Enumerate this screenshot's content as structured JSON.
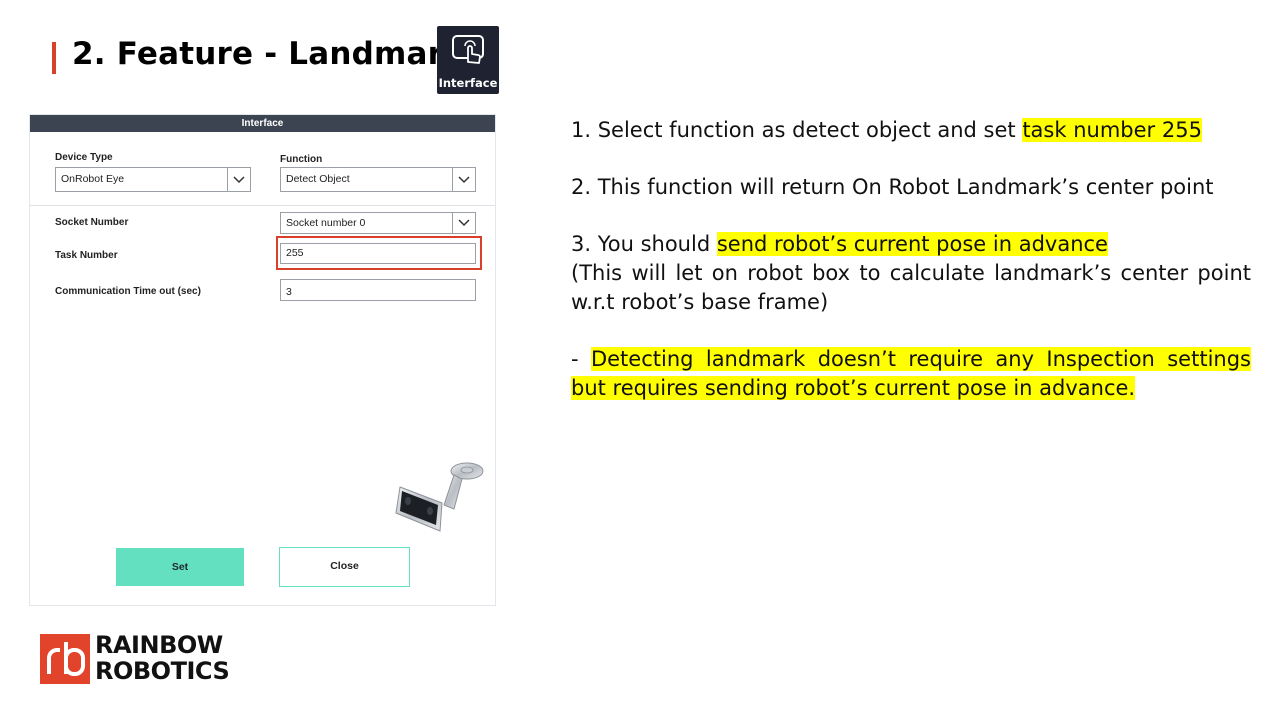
{
  "slide": {
    "title": "2. Feature - Landmark",
    "badge_label": "Interface"
  },
  "dialog": {
    "header": "Interface",
    "device_type_label": "Device Type",
    "device_type_value": "OnRobot Eye",
    "function_label": "Function",
    "function_value": "Detect Object",
    "socket_label": "Socket Number",
    "socket_value": "Socket number 0",
    "task_label": "Task Number",
    "task_value": "255",
    "timeout_label": "Communication Time out (sec)",
    "timeout_value": "3",
    "set_button": "Set",
    "close_button": "Close"
  },
  "notes": {
    "line1_a": "1. Select function as detect object and set ",
    "line1_hl": "task number 255",
    "line2": "2. This function will return On Robot Landmark’s center point",
    "line3_a": "3. You should ",
    "line3_hl": "send robot’s current pose in advance",
    "line4": "(This will let on robot box to calculate landmark’s center point w.r.t robot’s base frame)",
    "line5_a": "- ",
    "line5_hl": "Detecting landmark doesn’t require any Inspection settings but requires sending robot’s current pose in advance."
  },
  "logo": {
    "line1": "RAINBOW",
    "line2": "ROBOTICS"
  },
  "colors": {
    "accent_red": "#d9402b",
    "highlight_yellow": "#ffff00",
    "button_teal": "#62e0c0",
    "header_dark": "#3d4451"
  }
}
